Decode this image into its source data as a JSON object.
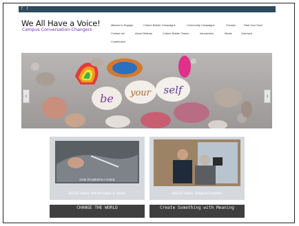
{
  "site": {
    "title": "We All Have a Voice!",
    "tagline": "Campus Conversation-Changers"
  },
  "social": [
    "f",
    "t"
  ],
  "nav": {
    "row1": [
      "Mission to Engage",
      "Culture Builder Campaigns",
      "Community Campaigns",
      "Surveys",
      "Start Your Own!"
    ],
    "row2": [
      "Contact Us!",
      "About Melinda",
      "Culture Builder Teams",
      "Introduction",
      "Media",
      "Outreach"
    ],
    "row3": [
      "Contributors"
    ]
  },
  "hero": {
    "shell_words": [
      "be",
      "your",
      "self"
    ]
  },
  "slider": {
    "prev_glyph": "‹",
    "next_glyph": "›"
  },
  "tiles": [
    {
      "caption": "ASCD Video: We All Have a Voice!",
      "overlay": "GIVE STUDENTS A VOICE"
    },
    {
      "caption": "ASCD Video: Adopt A Freshie!"
    }
  ],
  "strips": [
    {
      "text": "CHANGE THE WORLD"
    },
    {
      "text": "Create Something with Meaning"
    }
  ],
  "colors": {
    "topbar": "#2f4a5e",
    "tagline": "#6a2bb0",
    "caption": "#ffffff"
  }
}
